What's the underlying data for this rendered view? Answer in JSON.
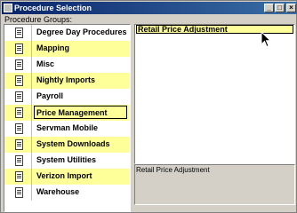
{
  "window": {
    "title": "Procedure Selection"
  },
  "groups_label": "Procedure Groups:",
  "groups": [
    {
      "label": "Degree Day Procedures",
      "highlighted": false,
      "selected": false
    },
    {
      "label": "Mapping",
      "highlighted": true,
      "selected": false
    },
    {
      "label": "Misc",
      "highlighted": false,
      "selected": false
    },
    {
      "label": "Nightly Imports",
      "highlighted": true,
      "selected": false
    },
    {
      "label": "Payroll",
      "highlighted": false,
      "selected": false
    },
    {
      "label": "Price Management",
      "highlighted": true,
      "selected": true
    },
    {
      "label": "Servman Mobile",
      "highlighted": false,
      "selected": false
    },
    {
      "label": "System Downloads",
      "highlighted": true,
      "selected": false
    },
    {
      "label": "System Utilities",
      "highlighted": false,
      "selected": false
    },
    {
      "label": "Verizon Import",
      "highlighted": true,
      "selected": false
    },
    {
      "label": "Warehouse",
      "highlighted": false,
      "selected": false
    }
  ],
  "procedures": [
    {
      "label": "Retail Price Adjustment"
    }
  ],
  "description": "Retail Price Adjustment",
  "colors": {
    "highlight": "#ffff99",
    "title_start": "#0a246a",
    "title_end": "#3a6ea5"
  }
}
